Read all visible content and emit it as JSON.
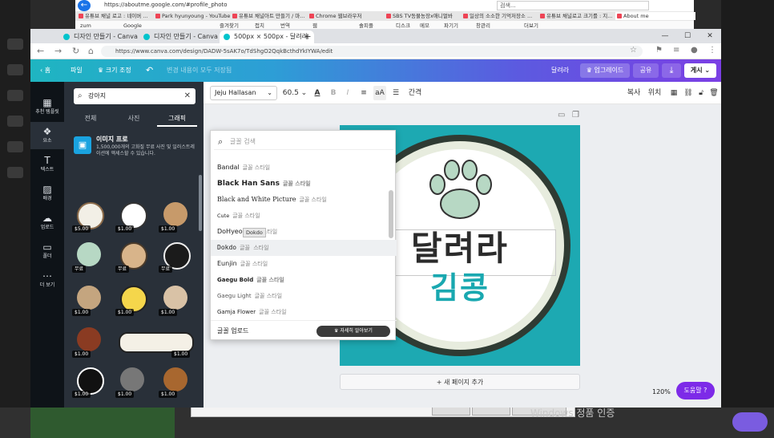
{
  "desktop": {
    "watermark": "Windows 정품 인증",
    "help_label": "도움말"
  },
  "back_browser": {
    "url": "https://aboutme.google.com/#profile_photo",
    "search_placeholder": "검색...",
    "tabs": [
      "유튜브 채널 로고 : 네이버 ...",
      "Park hyunyoung - YouTube",
      "유튜브 채널아트 만들기 / 마...",
      "Chrome 웹브라우저",
      "SBS TV동물농장x애니멀봐",
      "일상의 소소한 기억저장소 ...",
      "유튜브 채널로고 크기를 : 지...",
      "About me"
    ],
    "bookmarks": [
      "zum",
      "Google",
      "즐겨찾기",
      "접치",
      "번역",
      "웹",
      "솔피플",
      "디스크",
      "메모",
      "파기기",
      "창관리",
      "더보기"
    ]
  },
  "chrome": {
    "tabs": [
      {
        "title": "디자인 만들기 - Canva"
      },
      {
        "title": "디자인 만들기 - Canva"
      },
      {
        "title": "500px × 500px - 달려라"
      }
    ],
    "url": "https://www.canva.com/design/DADW-5sAK7o/TdShgO2QqkBcthdYkIYWA/edit"
  },
  "canva_bar": {
    "home": "홈",
    "file": "파일",
    "resize": "크기 조정",
    "status": "변경 내용이 모두 저장됨",
    "doc_title": "달려라",
    "upgrade": "업그레이드",
    "share": "공유",
    "publish": "게시"
  },
  "rail": [
    {
      "label": "추천 템플릿",
      "icon": "▦"
    },
    {
      "label": "요소",
      "icon": "❖"
    },
    {
      "label": "텍스트",
      "icon": "T"
    },
    {
      "label": "배경",
      "icon": "▨"
    },
    {
      "label": "업로드",
      "icon": "☁"
    },
    {
      "label": "폴더",
      "icon": "▭"
    },
    {
      "label": "더 보기",
      "icon": "⋯"
    }
  ],
  "panel": {
    "search_value": "강아지",
    "tabs": [
      "전체",
      "사진",
      "그래픽"
    ],
    "promo_title": "이미지 프로",
    "promo_desc": "1,500,000개의 고화질 무료 사진 및 일러스트레이션에 액세스할 수 있습니다.",
    "badges": [
      "$5.00",
      "$1.00",
      "$1.00",
      "무료",
      "무료",
      "무료",
      "$1.00",
      "$1.00",
      "$1.00",
      "$1.00",
      "$1.00",
      "$1.00",
      "$1.00",
      "$1.00",
      "$1.00"
    ]
  },
  "toolbar": {
    "font": "Jeju Hallasan",
    "size": "60.5",
    "spacing": "간격",
    "copy": "복사",
    "position": "위치"
  },
  "font_dropdown": {
    "search_placeholder": "글꼴 검색",
    "fonts": [
      {
        "name": "Bandal",
        "sample": "글꼴 스타일"
      },
      {
        "name": "Black Han Sans",
        "sample": "글꼴 스타일"
      },
      {
        "name": "Black and White Picture",
        "sample": "글꼴 스타일"
      },
      {
        "name": "Cute",
        "sample": "글꼴 스타일"
      },
      {
        "name": "DoHyeon",
        "sample": "글꼴 스타일"
      },
      {
        "name": "Dokdo",
        "sample": "글꼴 스타일"
      },
      {
        "name": "Eunjin",
        "sample": "글꼴 스타일"
      },
      {
        "name": "Gaegu Bold",
        "sample": "글꼴 스타일"
      },
      {
        "name": "Gaegu Light",
        "sample": "글꼴 스타일"
      },
      {
        "name": "Gamja Flower",
        "sample": "글꼴 스타일"
      }
    ],
    "tooltip": "Dokdo",
    "upload_label": "글꼴 업로드",
    "upload_btn": "자세히 알아보기"
  },
  "design": {
    "title": "달려라",
    "subtitle": "김콩",
    "add_page": "+ 새 페이지 추가",
    "zoom": "120%"
  }
}
